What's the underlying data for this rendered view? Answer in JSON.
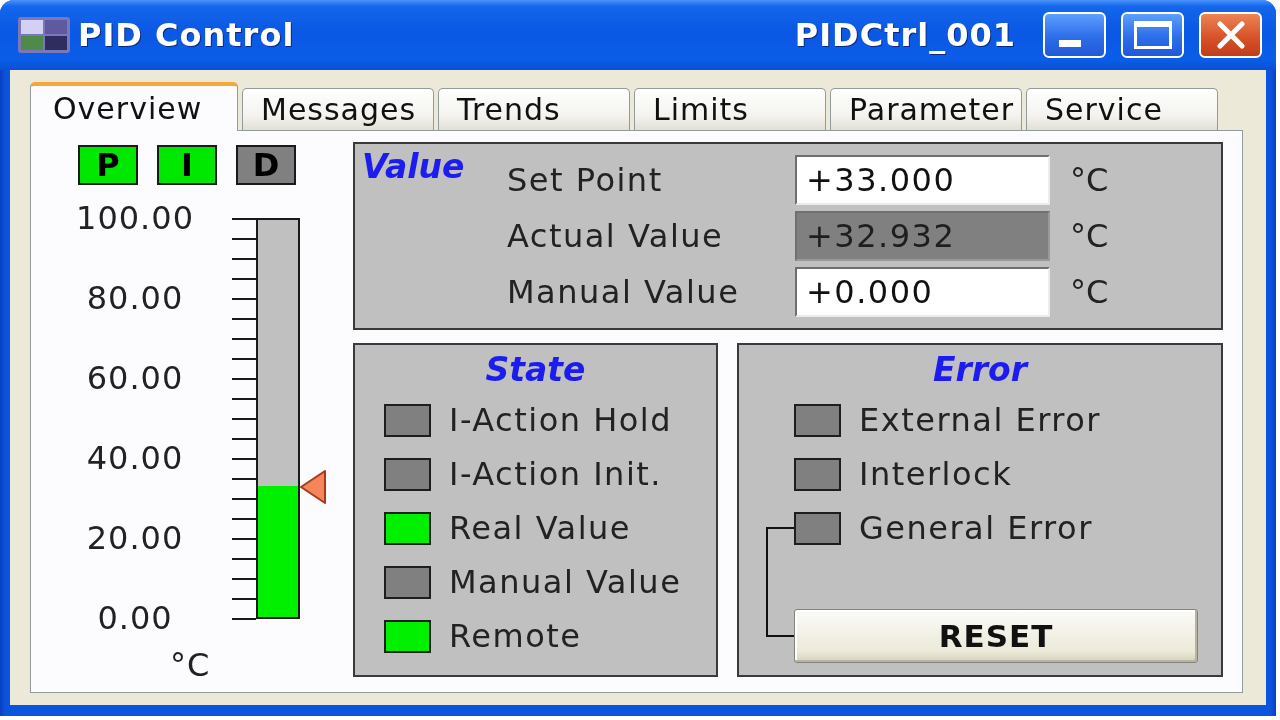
{
  "window": {
    "title": "PID Control",
    "instance": "PIDCtrl_001"
  },
  "tabs": [
    {
      "label": "Overview",
      "selected": true
    },
    {
      "label": "Messages",
      "selected": false
    },
    {
      "label": "Trends",
      "selected": false
    },
    {
      "label": "Limits",
      "selected": false
    },
    {
      "label": "Parameter",
      "selected": false
    },
    {
      "label": "Service",
      "selected": false
    }
  ],
  "mode_indicators": [
    {
      "label": "P",
      "on": true
    },
    {
      "label": "I",
      "on": true
    },
    {
      "label": "D",
      "on": false
    }
  ],
  "bar_gauge": {
    "scale": [
      "100.00",
      "80.00",
      "60.00",
      "40.00",
      "20.00",
      "0.00"
    ],
    "level": 0.33,
    "setpoint_marker": {
      "level": 0.33
    },
    "unit": "°C"
  },
  "value": {
    "title": "Value",
    "rows": [
      {
        "label": "Set Point",
        "value": "+33.000",
        "readonly": false,
        "unit": "°C"
      },
      {
        "label": "Actual Value",
        "value": "+32.932",
        "readonly": true,
        "unit": "°C"
      },
      {
        "label": "Manual Value",
        "value": "+0.000",
        "readonly": false,
        "unit": "°C"
      }
    ]
  },
  "state": {
    "title": "State",
    "items": [
      {
        "label": "I-Action Hold",
        "on": false
      },
      {
        "label": "I-Action Init.",
        "on": false
      },
      {
        "label": "Real Value",
        "on": true
      },
      {
        "label": "Manual Value",
        "on": false
      },
      {
        "label": "Remote",
        "on": true
      }
    ]
  },
  "error": {
    "title": "Error",
    "items": [
      {
        "label": "External Error",
        "on": false
      },
      {
        "label": "Interlock",
        "on": false
      },
      {
        "label": "General Error",
        "on": false
      }
    ],
    "reset_button": "RESET"
  }
}
